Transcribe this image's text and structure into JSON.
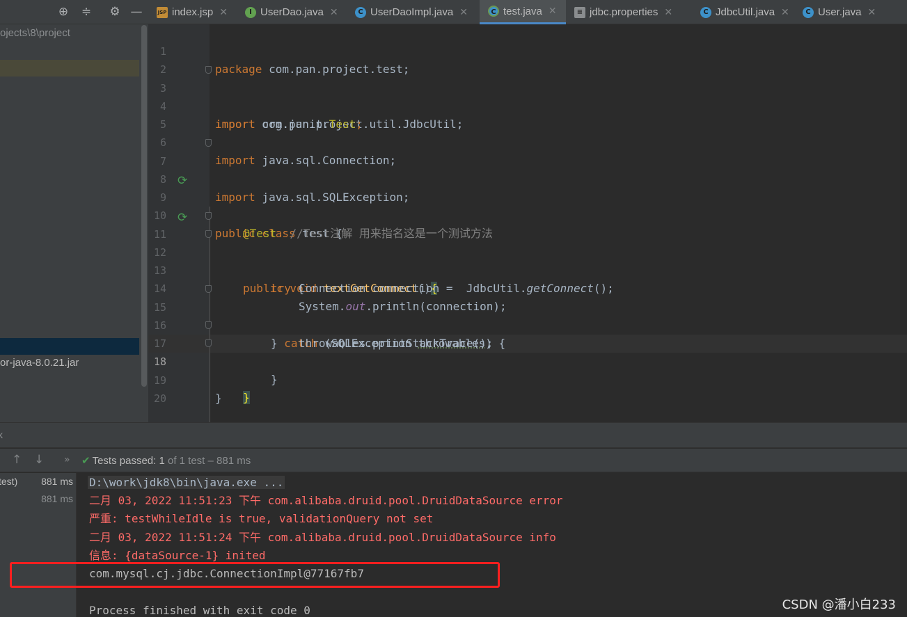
{
  "project_panel": {
    "path_text": "ojects\\8\\project",
    "tree_item_jar": "or-java-8.0.21.jar",
    "icons": [
      "crosshair-icon",
      "collapse-icon",
      "gear-icon",
      "minimize-icon"
    ]
  },
  "tabs": [
    {
      "label": "index.jsp",
      "icon": "jsp-file-icon",
      "active": false
    },
    {
      "label": "UserDao.java",
      "icon": "interface-icon",
      "active": false
    },
    {
      "label": "UserDaoImpl.java",
      "icon": "class-icon",
      "active": false
    },
    {
      "label": "test.java",
      "icon": "test-class-icon",
      "active": true
    },
    {
      "label": "jdbc.properties",
      "icon": "properties-file-icon",
      "active": false
    },
    {
      "label": "JdbcUtil.java",
      "icon": "class-icon",
      "active": false
    },
    {
      "label": "User.java",
      "icon": "class-icon",
      "active": false
    }
  ],
  "editor": {
    "current_line": 18,
    "line_numbers": [
      "1",
      "2",
      "3",
      "4",
      "5",
      "6",
      "7",
      "8",
      "9",
      "10",
      "11",
      "12",
      "13",
      "14",
      "15",
      "16",
      "17",
      "18",
      "19",
      "20"
    ],
    "code": {
      "l1_kw": "package",
      "l1_rest": " com.pan.project.test;",
      "l3_kw": "import",
      "l3_rest": " com.pan.project.util.JdbcUtil;",
      "l4_kw": "import",
      "l4_a": " org.junit.",
      "l4_b": "Test",
      "l4_c": ";",
      "l6_kw": "import",
      "l6_rest": " java.sql.Connection;",
      "l7_kw": "import",
      "l7_rest": " java.sql.SQLException;",
      "l9_kw": "public class",
      "l9_rest": " test {",
      "l10_ann": "@Test",
      "l10_cmt": "  //Test注解 用来指名这是一个测试方法",
      "l11_kw": "public void",
      "l11_fn": " textGetConnect",
      "l11_rest": "()",
      "l11_brace": "{",
      "l12_kw": "try",
      "l12_rest": " {",
      "l13_a": "Connection connection =  JdbcUtil.",
      "l13_b": "getConnect",
      "l13_c": "();",
      "l14_a": "System.",
      "l14_b": "out",
      "l14_c": ".println(connection);",
      "l15_a": "} ",
      "l15_kw": "catch",
      "l15_b": " (SQLException ",
      "l15_c": "throwables",
      "l15_d": ") {",
      "l16": "throwables.printStackTrace();",
      "l17": "}",
      "l18": "}",
      "l19": "}"
    }
  },
  "run_panel": {
    "header_label": "k",
    "tests_passed_label": "Tests passed:",
    "tests_passed_count": "1",
    "tests_passed_rest": "of 1 test – 881 ms",
    "tree": [
      {
        "name": "test)",
        "time": "881 ms"
      },
      {
        "name": "",
        "time": "881 ms"
      }
    ],
    "console": {
      "cmd": "D:\\work\\jdk8\\bin\\java.exe ...",
      "err1": "二月 03, 2022 11:51:23 下午 com.alibaba.druid.pool.DruidDataSource error",
      "err2": "严重: testWhileIdle is true, validationQuery not set",
      "err3": "二月 03, 2022 11:51:24 下午 com.alibaba.druid.pool.DruidDataSource info",
      "err4": "信息: {dataSource-1} inited",
      "out1": "com.mysql.cj.jdbc.ConnectionImpl@77167fb7",
      "out2": "Process finished with exit code 0"
    }
  },
  "watermark": "CSDN @潘小白233",
  "colors": {
    "keyword": "#cc7832",
    "annotation": "#bbb529",
    "method": "#ffc66d",
    "error_text": "#ff6b68",
    "highlight_box": "#ff1f1f",
    "test_pass": "#499c54"
  }
}
